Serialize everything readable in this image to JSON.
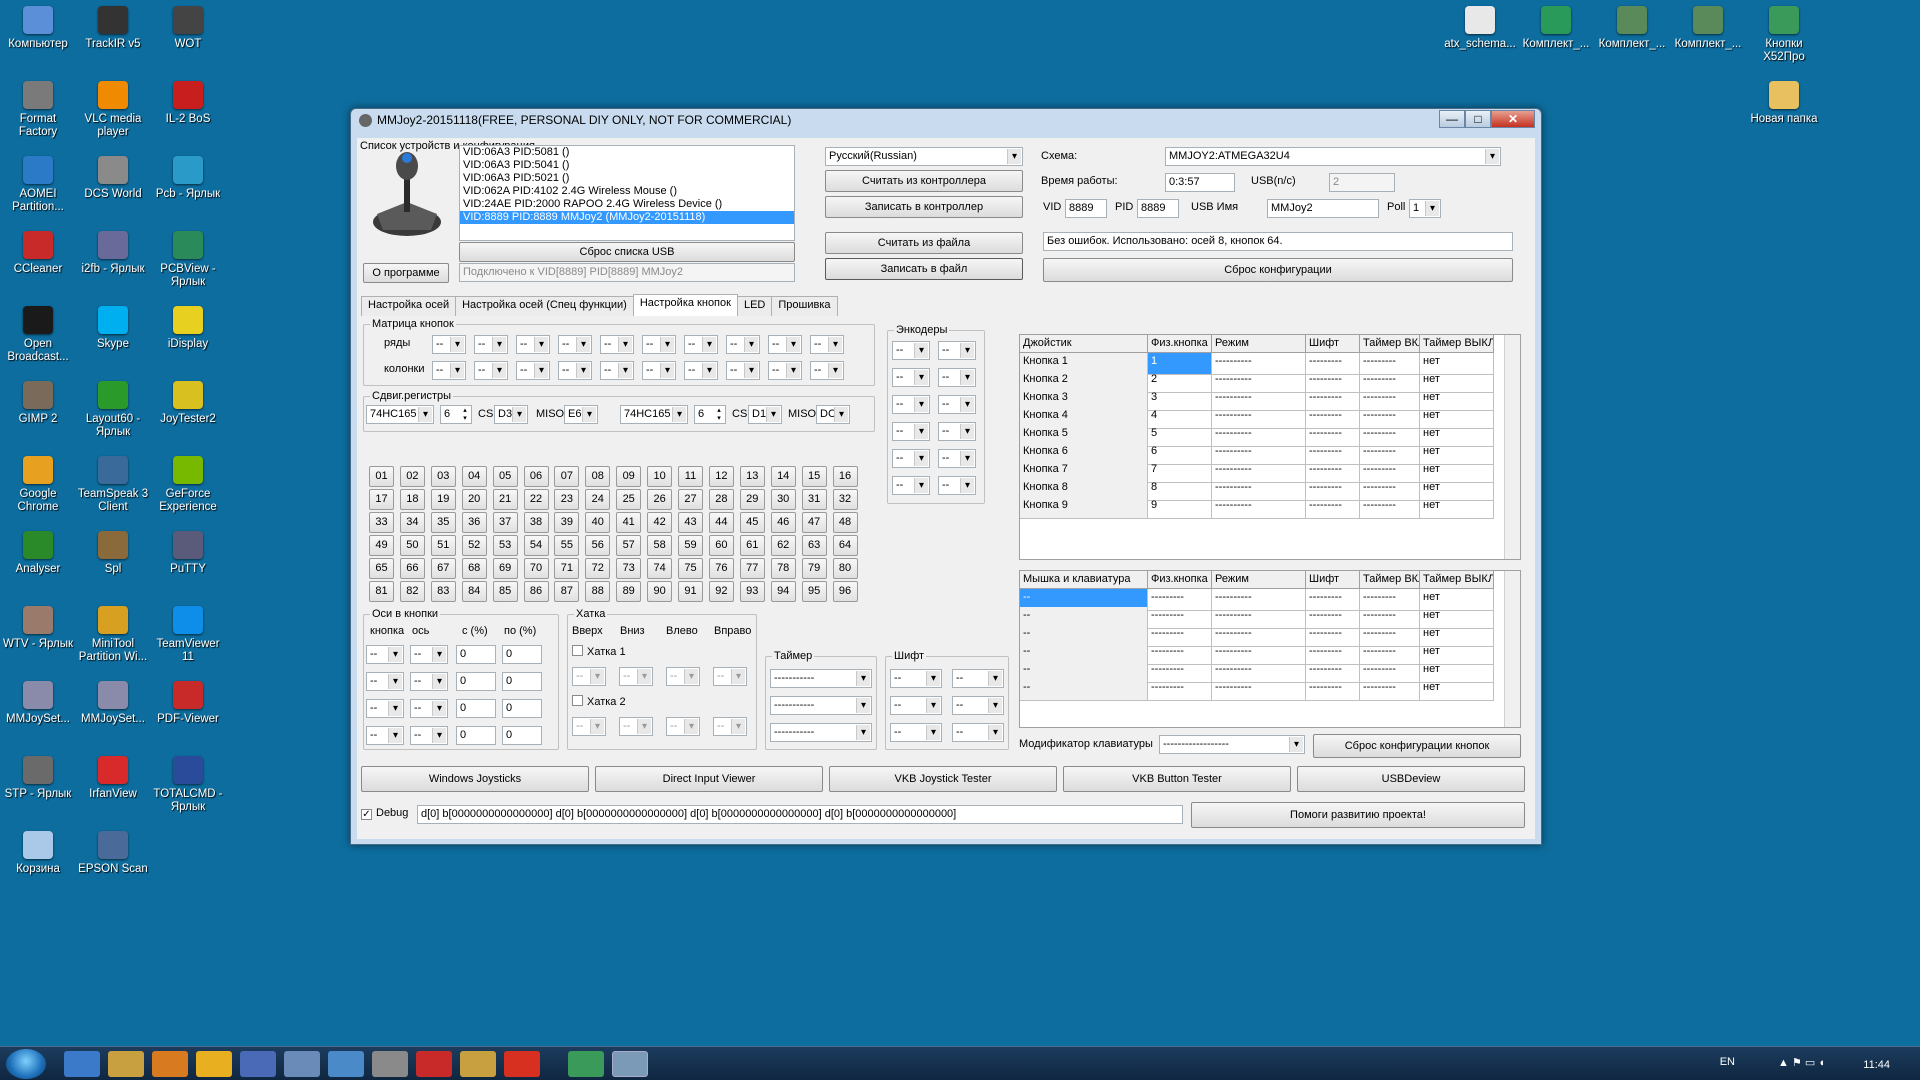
{
  "desktop": {
    "left_icons": [
      {
        "label": "Компьютер",
        "color": "#5b8fd8"
      },
      {
        "label": "TrackIR v5",
        "color": "#333333"
      },
      {
        "label": "WOT",
        "color": "#444444"
      },
      {
        "label": "Format Factory",
        "color": "#7a7a7a"
      },
      {
        "label": "VLC media player",
        "color": "#f08a00"
      },
      {
        "label": "IL-2 BoS",
        "color": "#c81e1e"
      },
      {
        "label": "AOMEI Partition...",
        "color": "#2a7ac8"
      },
      {
        "label": "DCS World",
        "color": "#8a8a8a"
      },
      {
        "label": "Pcb - Ярлык",
        "color": "#2a9ac8"
      },
      {
        "label": "CCleaner",
        "color": "#c82a2a"
      },
      {
        "label": "i2fb - Ярлык",
        "color": "#6a6a9a"
      },
      {
        "label": "PCBView - Ярлык",
        "color": "#2a8a5a"
      },
      {
        "label": "Open Broadcast...",
        "color": "#1a1a1a"
      },
      {
        "label": "Skype",
        "color": "#00aff0"
      },
      {
        "label": "iDisplay",
        "color": "#e8d020"
      },
      {
        "label": "GIMP 2",
        "color": "#7a6a5a"
      },
      {
        "label": "Layout60 - Ярлык",
        "color": "#2a9a2a"
      },
      {
        "label": "JoyTester2",
        "color": "#d8c020"
      },
      {
        "label": "Google Chrome",
        "color": "#e8a020"
      },
      {
        "label": "TeamSpeak 3 Client",
        "color": "#3a6a9a"
      },
      {
        "label": "GeForce Experience",
        "color": "#76b900"
      },
      {
        "label": "Analyser",
        "color": "#2a8a2a"
      },
      {
        "label": "Spl",
        "color": "#8a6a3a"
      },
      {
        "label": "PuTTY",
        "color": "#5a5a7a"
      },
      {
        "label": "WTV - Ярлык",
        "color": "#9a7a6a"
      },
      {
        "label": "MiniTool Partition Wi...",
        "color": "#d8a020"
      },
      {
        "label": "TeamViewer 11",
        "color": "#0e8ee9"
      },
      {
        "label": "MMJoySet...",
        "color": "#8a8aaa"
      },
      {
        "label": "MMJoySet...",
        "color": "#8a8aaa"
      },
      {
        "label": "PDF-Viewer",
        "color": "#c82a2a"
      },
      {
        "label": "STP - Ярлык",
        "color": "#6a6a6a"
      },
      {
        "label": "IrfanView",
        "color": "#d82a2a"
      },
      {
        "label": "TOTALCMD - Ярлык",
        "color": "#2a4a9a"
      },
      {
        "label": "Корзина",
        "color": "#aac8e8"
      },
      {
        "label": "EPSON Scan",
        "color": "#4a6a9a"
      }
    ],
    "right_icons": [
      {
        "label": "atx_schema...",
        "color": "#e8e8e8"
      },
      {
        "label": "Комплект_...",
        "color": "#2a9a5a"
      },
      {
        "label": "Комплект_...",
        "color": "#5a8a5a"
      },
      {
        "label": "Комплект_...",
        "color": "#5a8a5a"
      },
      {
        "label": "Кнопки X52Про",
        "color": "#3a9a5a"
      },
      {
        "label": "Новая папка",
        "color": "#e8c060"
      }
    ]
  },
  "taskbar": {
    "lang": "EN",
    "time": "11:44"
  },
  "window": {
    "title": "MMJoy2-20151118(FREE, PERSONAL DIY ONLY, NOT FOR COMMERCIAL)",
    "btn_min": "—",
    "btn_max": "□",
    "btn_close": "✕",
    "devices_group": "Список устройств и конфигурация",
    "devices": [
      "VID:06A3 PID:5081  ()",
      "VID:06A3 PID:5041  ()",
      "VID:06A3 PID:5021  ()",
      "VID:062A PID:4102 2.4G Wireless Mouse ()",
      "VID:24AE PID:2000 RAPOO 2.4G Wireless Device ()",
      "VID:8889 PID:8889 MMJoy2 (MMJoy2-20151118)"
    ],
    "reset_usb": "Сброс списка USB",
    "about": "О программе",
    "connected": "Подключено к VID[8889] PID[8889] MMJoy2",
    "language": "Русский(Russian)",
    "read_ctrl": "Считать из контроллера",
    "write_ctrl": "Записать в контроллер",
    "read_file": "Считать из файла",
    "write_file": "Записать в файл",
    "schema_label": "Схема:",
    "schema": "MMJOY2:ATMEGA32U4",
    "uptime_label": "Время работы:",
    "uptime": "0:3:57",
    "usb_ns_label": "USB(n/c)",
    "usb_ns": "2",
    "vid_label": "VID",
    "vid": "8889",
    "pid_label": "PID",
    "pid": "8889",
    "usbname_label": "USB Имя",
    "usbname": "MMJoy2",
    "poll_label": "Poll",
    "poll": "1",
    "status": "Без ошибок. Использовано: осей  8, кнопок  64.",
    "reset_config": "Сброс конфигурации",
    "tabs": [
      "Настройка осей",
      "Настройка осей (Спец функции)",
      "Настройка кнопок",
      "LED",
      "Прошивка"
    ],
    "matrix_group": "Матрица кнопок",
    "rows_label": "ряды",
    "cols_label": "колонки",
    "dash": "--",
    "shift_group": "Сдвиг.регистры",
    "sr1_type": "74HC165",
    "sr1_n": "6",
    "cs_label": "CS",
    "sr1_cs": "D3",
    "miso_label": "MISO",
    "sr1_miso": "E6",
    "sr2_type": "74HC165",
    "sr2_n": "6",
    "sr2_cs": "D1",
    "sr2_miso": "DC",
    "buttons": [
      "01",
      "02",
      "03",
      "04",
      "05",
      "06",
      "07",
      "08",
      "09",
      "10",
      "11",
      "12",
      "13",
      "14",
      "15",
      "16",
      "17",
      "18",
      "19",
      "20",
      "21",
      "22",
      "23",
      "24",
      "25",
      "26",
      "27",
      "28",
      "29",
      "30",
      "31",
      "32",
      "33",
      "34",
      "35",
      "36",
      "37",
      "38",
      "39",
      "40",
      "41",
      "42",
      "43",
      "44",
      "45",
      "46",
      "47",
      "48",
      "49",
      "50",
      "51",
      "52",
      "53",
      "54",
      "55",
      "56",
      "57",
      "58",
      "59",
      "60",
      "61",
      "62",
      "63",
      "64",
      "65",
      "66",
      "67",
      "68",
      "69",
      "70",
      "71",
      "72",
      "73",
      "74",
      "75",
      "76",
      "77",
      "78",
      "79",
      "80",
      "81",
      "82",
      "83",
      "84",
      "85",
      "86",
      "87",
      "88",
      "89",
      "90",
      "91",
      "92",
      "93",
      "94",
      "95",
      "96"
    ],
    "axes_group": "Оси в кнопки",
    "axes_h": [
      "кнопка",
      "ось",
      "с (%)",
      "по (%)"
    ],
    "zero": "0",
    "hat_group": "Хатка",
    "hat_h": [
      "Вверх",
      "Вниз",
      "Влево",
      "Вправо"
    ],
    "hat1": "Хатка 1",
    "hat2": "Хатка 2",
    "timer_group": "Таймер",
    "shift2_group": "Шифт",
    "encoders_group": "Энкодеры",
    "dashes": "-----------",
    "joy_headers": [
      "Джойстик",
      "Физ.кнопка",
      "Режим",
      "Шифт",
      "Таймер ВКЛ",
      "Таймер ВЫКЛ"
    ],
    "joy_rows": [
      [
        "Кнопка 1",
        "1",
        "----------",
        "---------",
        "---------",
        "нет"
      ],
      [
        "Кнопка 2",
        "2",
        "----------",
        "---------",
        "---------",
        "нет"
      ],
      [
        "Кнопка 3",
        "3",
        "----------",
        "---------",
        "---------",
        "нет"
      ],
      [
        "Кнопка 4",
        "4",
        "----------",
        "---------",
        "---------",
        "нет"
      ],
      [
        "Кнопка 5",
        "5",
        "----------",
        "---------",
        "---------",
        "нет"
      ],
      [
        "Кнопка 6",
        "6",
        "----------",
        "---------",
        "---------",
        "нет"
      ],
      [
        "Кнопка 7",
        "7",
        "----------",
        "---------",
        "---------",
        "нет"
      ],
      [
        "Кнопка 8",
        "8",
        "----------",
        "---------",
        "---------",
        "нет"
      ],
      [
        "Кнопка 9",
        "9",
        "----------",
        "---------",
        "---------",
        "нет"
      ]
    ],
    "kb_headers": [
      "Мышка и клавиатура",
      "Физ.кнопка",
      "Режим",
      "Шифт",
      "Таймер ВКЛ",
      "Таймер ВЫКЛ"
    ],
    "kb_rows": [
      [
        "--",
        "---------",
        "----------",
        "---------",
        "---------",
        "нет"
      ],
      [
        "--",
        "---------",
        "----------",
        "---------",
        "---------",
        "нет"
      ],
      [
        "--",
        "---------",
        "----------",
        "---------",
        "---------",
        "нет"
      ],
      [
        "--",
        "---------",
        "----------",
        "---------",
        "---------",
        "нет"
      ],
      [
        "--",
        "---------",
        "----------",
        "---------",
        "---------",
        "нет"
      ],
      [
        "--",
        "---------",
        "----------",
        "---------",
        "---------",
        "нет"
      ]
    ],
    "kb_mod_label": "Модификатор клавиатуры",
    "kb_mod": "------------------",
    "reset_buttons": "Сброс конфигурации кнопок",
    "bottom": [
      "Windows Joysticks",
      "Direct Input Viewer",
      "VKB Joystick Tester",
      "VKB Button Tester",
      "USBDeview"
    ],
    "debug_label": "Debug",
    "debug_text": "d[0] b[0000000000000000]   d[0] b[0000000000000000]   d[0] b[0000000000000000]   d[0] b[0000000000000000]",
    "help": "Помоги развитию проекта!"
  }
}
